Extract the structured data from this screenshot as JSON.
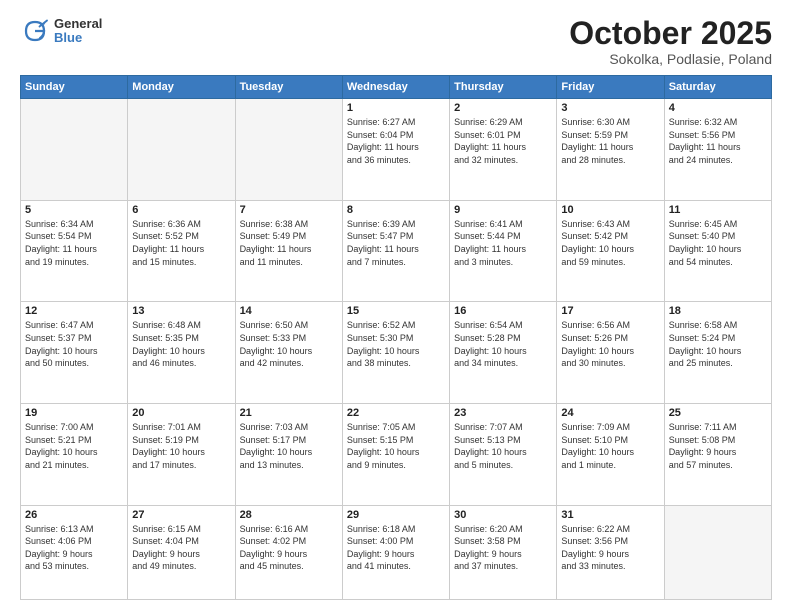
{
  "header": {
    "logo_general": "General",
    "logo_blue": "Blue",
    "month_title": "October 2025",
    "location": "Sokolka, Podlasie, Poland"
  },
  "days_of_week": [
    "Sunday",
    "Monday",
    "Tuesday",
    "Wednesday",
    "Thursday",
    "Friday",
    "Saturday"
  ],
  "weeks": [
    [
      {
        "day": "",
        "info": ""
      },
      {
        "day": "",
        "info": ""
      },
      {
        "day": "",
        "info": ""
      },
      {
        "day": "1",
        "info": "Sunrise: 6:27 AM\nSunset: 6:04 PM\nDaylight: 11 hours\nand 36 minutes."
      },
      {
        "day": "2",
        "info": "Sunrise: 6:29 AM\nSunset: 6:01 PM\nDaylight: 11 hours\nand 32 minutes."
      },
      {
        "day": "3",
        "info": "Sunrise: 6:30 AM\nSunset: 5:59 PM\nDaylight: 11 hours\nand 28 minutes."
      },
      {
        "day": "4",
        "info": "Sunrise: 6:32 AM\nSunset: 5:56 PM\nDaylight: 11 hours\nand 24 minutes."
      }
    ],
    [
      {
        "day": "5",
        "info": "Sunrise: 6:34 AM\nSunset: 5:54 PM\nDaylight: 11 hours\nand 19 minutes."
      },
      {
        "day": "6",
        "info": "Sunrise: 6:36 AM\nSunset: 5:52 PM\nDaylight: 11 hours\nand 15 minutes."
      },
      {
        "day": "7",
        "info": "Sunrise: 6:38 AM\nSunset: 5:49 PM\nDaylight: 11 hours\nand 11 minutes."
      },
      {
        "day": "8",
        "info": "Sunrise: 6:39 AM\nSunset: 5:47 PM\nDaylight: 11 hours\nand 7 minutes."
      },
      {
        "day": "9",
        "info": "Sunrise: 6:41 AM\nSunset: 5:44 PM\nDaylight: 11 hours\nand 3 minutes."
      },
      {
        "day": "10",
        "info": "Sunrise: 6:43 AM\nSunset: 5:42 PM\nDaylight: 10 hours\nand 59 minutes."
      },
      {
        "day": "11",
        "info": "Sunrise: 6:45 AM\nSunset: 5:40 PM\nDaylight: 10 hours\nand 54 minutes."
      }
    ],
    [
      {
        "day": "12",
        "info": "Sunrise: 6:47 AM\nSunset: 5:37 PM\nDaylight: 10 hours\nand 50 minutes."
      },
      {
        "day": "13",
        "info": "Sunrise: 6:48 AM\nSunset: 5:35 PM\nDaylight: 10 hours\nand 46 minutes."
      },
      {
        "day": "14",
        "info": "Sunrise: 6:50 AM\nSunset: 5:33 PM\nDaylight: 10 hours\nand 42 minutes."
      },
      {
        "day": "15",
        "info": "Sunrise: 6:52 AM\nSunset: 5:30 PM\nDaylight: 10 hours\nand 38 minutes."
      },
      {
        "day": "16",
        "info": "Sunrise: 6:54 AM\nSunset: 5:28 PM\nDaylight: 10 hours\nand 34 minutes."
      },
      {
        "day": "17",
        "info": "Sunrise: 6:56 AM\nSunset: 5:26 PM\nDaylight: 10 hours\nand 30 minutes."
      },
      {
        "day": "18",
        "info": "Sunrise: 6:58 AM\nSunset: 5:24 PM\nDaylight: 10 hours\nand 25 minutes."
      }
    ],
    [
      {
        "day": "19",
        "info": "Sunrise: 7:00 AM\nSunset: 5:21 PM\nDaylight: 10 hours\nand 21 minutes."
      },
      {
        "day": "20",
        "info": "Sunrise: 7:01 AM\nSunset: 5:19 PM\nDaylight: 10 hours\nand 17 minutes."
      },
      {
        "day": "21",
        "info": "Sunrise: 7:03 AM\nSunset: 5:17 PM\nDaylight: 10 hours\nand 13 minutes."
      },
      {
        "day": "22",
        "info": "Sunrise: 7:05 AM\nSunset: 5:15 PM\nDaylight: 10 hours\nand 9 minutes."
      },
      {
        "day": "23",
        "info": "Sunrise: 7:07 AM\nSunset: 5:13 PM\nDaylight: 10 hours\nand 5 minutes."
      },
      {
        "day": "24",
        "info": "Sunrise: 7:09 AM\nSunset: 5:10 PM\nDaylight: 10 hours\nand 1 minute."
      },
      {
        "day": "25",
        "info": "Sunrise: 7:11 AM\nSunset: 5:08 PM\nDaylight: 9 hours\nand 57 minutes."
      }
    ],
    [
      {
        "day": "26",
        "info": "Sunrise: 6:13 AM\nSunset: 4:06 PM\nDaylight: 9 hours\nand 53 minutes."
      },
      {
        "day": "27",
        "info": "Sunrise: 6:15 AM\nSunset: 4:04 PM\nDaylight: 9 hours\nand 49 minutes."
      },
      {
        "day": "28",
        "info": "Sunrise: 6:16 AM\nSunset: 4:02 PM\nDaylight: 9 hours\nand 45 minutes."
      },
      {
        "day": "29",
        "info": "Sunrise: 6:18 AM\nSunset: 4:00 PM\nDaylight: 9 hours\nand 41 minutes."
      },
      {
        "day": "30",
        "info": "Sunrise: 6:20 AM\nSunset: 3:58 PM\nDaylight: 9 hours\nand 37 minutes."
      },
      {
        "day": "31",
        "info": "Sunrise: 6:22 AM\nSunset: 3:56 PM\nDaylight: 9 hours\nand 33 minutes."
      },
      {
        "day": "",
        "info": ""
      }
    ]
  ]
}
